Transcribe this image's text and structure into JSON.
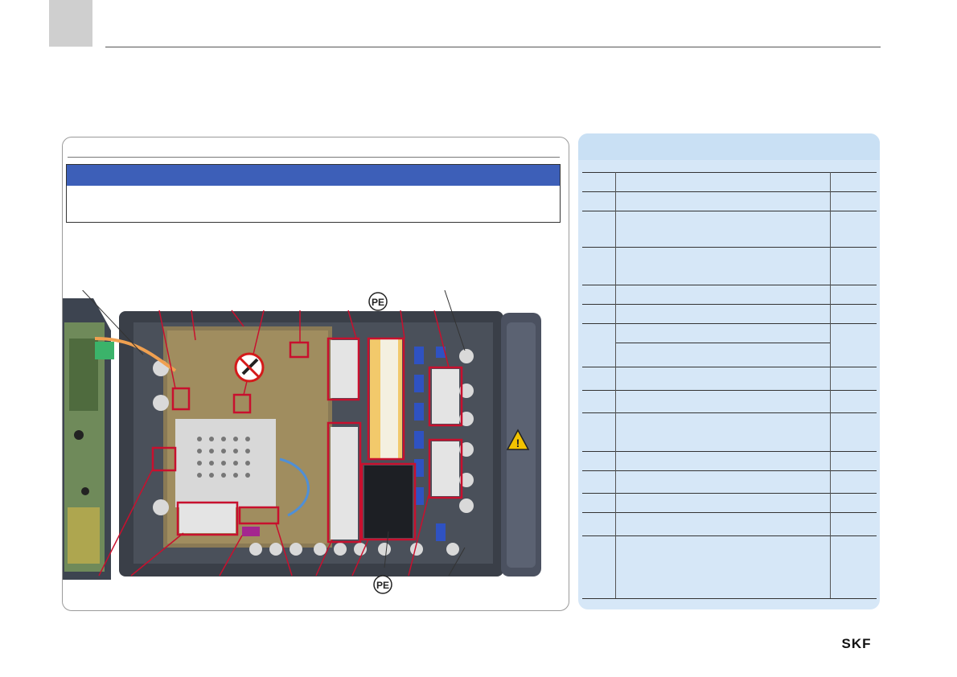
{
  "logo": {
    "text": "SKF"
  },
  "figure": {
    "pe_labels": [
      "PE",
      "PE"
    ]
  },
  "icons": {
    "no_plug": "no-plug-symbol-icon",
    "warning": "warning-triangle-icon"
  },
  "colors": {
    "accent_blue": "#3d5fb8",
    "table_bg": "#d6e7f7",
    "marker_red": "#c8102e",
    "tab_gray": "#cfcfcf"
  }
}
